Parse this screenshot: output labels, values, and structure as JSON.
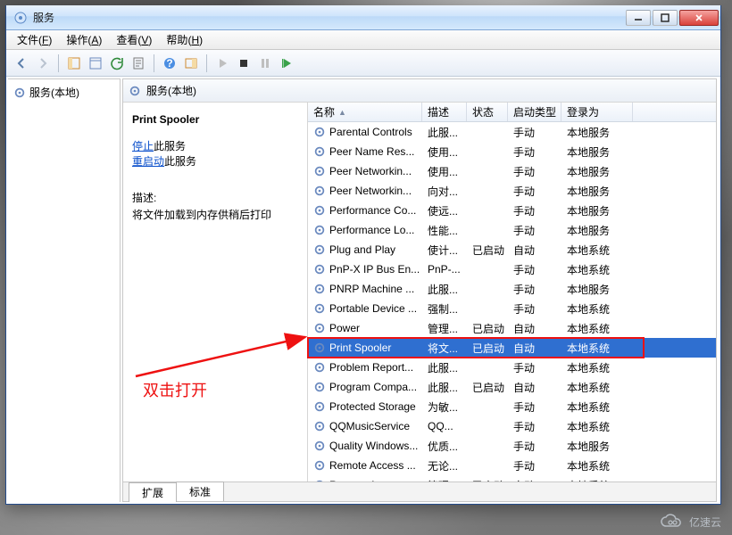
{
  "window": {
    "title": "服务"
  },
  "menu": {
    "file": {
      "label": "文件",
      "accel": "F"
    },
    "action": {
      "label": "操作",
      "accel": "A"
    },
    "view": {
      "label": "查看",
      "accel": "V"
    },
    "help": {
      "label": "帮助",
      "accel": "H"
    }
  },
  "tree": {
    "root_label": "服务(本地)"
  },
  "main": {
    "header_label": "服务(本地)",
    "detail": {
      "title": "Print Spooler",
      "stop_link": "停止",
      "restart_link": "重启动",
      "this_service": "此服务",
      "desc_label": "描述:",
      "desc_text": "将文件加载到内存供稍后打印"
    },
    "columns": {
      "name": "名称",
      "description": "描述",
      "status": "状态",
      "startup": "启动类型",
      "logon": "登录为"
    },
    "rows": [
      {
        "name": "Parental Controls",
        "description": "此服...",
        "status": "",
        "startup": "手动",
        "logon": "本地服务"
      },
      {
        "name": "Peer Name Res...",
        "description": "使用...",
        "status": "",
        "startup": "手动",
        "logon": "本地服务"
      },
      {
        "name": "Peer Networkin...",
        "description": "使用...",
        "status": "",
        "startup": "手动",
        "logon": "本地服务"
      },
      {
        "name": "Peer Networkin...",
        "description": "向对...",
        "status": "",
        "startup": "手动",
        "logon": "本地服务"
      },
      {
        "name": "Performance Co...",
        "description": "使远...",
        "status": "",
        "startup": "手动",
        "logon": "本地服务"
      },
      {
        "name": "Performance Lo...",
        "description": "性能...",
        "status": "",
        "startup": "手动",
        "logon": "本地服务"
      },
      {
        "name": "Plug and Play",
        "description": "使计...",
        "status": "已启动",
        "startup": "自动",
        "logon": "本地系统"
      },
      {
        "name": "PnP-X IP Bus En...",
        "description": "PnP-...",
        "status": "",
        "startup": "手动",
        "logon": "本地系统"
      },
      {
        "name": "PNRP Machine ...",
        "description": "此服...",
        "status": "",
        "startup": "手动",
        "logon": "本地服务"
      },
      {
        "name": "Portable Device ...",
        "description": "强制...",
        "status": "",
        "startup": "手动",
        "logon": "本地系统"
      },
      {
        "name": "Power",
        "description": "管理...",
        "status": "已启动",
        "startup": "自动",
        "logon": "本地系统"
      },
      {
        "name": "Print Spooler",
        "description": "将文...",
        "status": "已启动",
        "startup": "自动",
        "logon": "本地系统",
        "selected": true
      },
      {
        "name": "Problem Report...",
        "description": "此服...",
        "status": "",
        "startup": "手动",
        "logon": "本地系统"
      },
      {
        "name": "Program Compa...",
        "description": "此服...",
        "status": "已启动",
        "startup": "自动",
        "logon": "本地系统"
      },
      {
        "name": "Protected Storage",
        "description": "为敏...",
        "status": "",
        "startup": "手动",
        "logon": "本地系统"
      },
      {
        "name": "QQMusicService",
        "description": "QQ...",
        "status": "",
        "startup": "手动",
        "logon": "本地系统"
      },
      {
        "name": "Quality Windows...",
        "description": "优质...",
        "status": "",
        "startup": "手动",
        "logon": "本地服务"
      },
      {
        "name": "Remote Access ...",
        "description": "无论...",
        "status": "",
        "startup": "手动",
        "logon": "本地系统"
      },
      {
        "name": "Remote Access ...",
        "description": "管理...",
        "status": "已启动",
        "startup": "自动",
        "logon": "本地系统"
      }
    ],
    "tabs": {
      "extended": "扩展",
      "standard": "标准"
    }
  },
  "annotation": {
    "text": "双击打开"
  },
  "watermark": {
    "text": "亿速云"
  }
}
